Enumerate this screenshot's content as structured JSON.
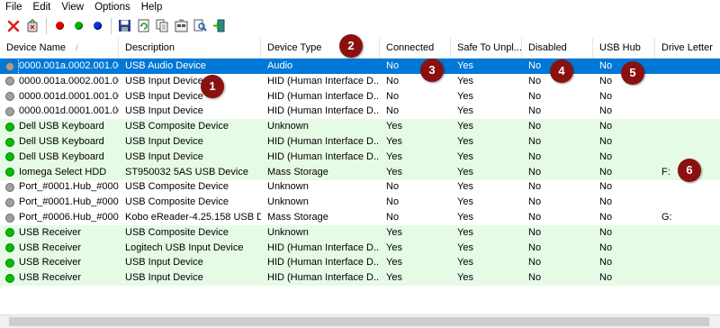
{
  "menu": [
    "File",
    "Edit",
    "View",
    "Options",
    "Help"
  ],
  "toolbar_icons": [
    "delete-icon",
    "uninstall-icon",
    "red-light-icon",
    "green-light-icon",
    "blue-light-icon",
    "save-icon",
    "refresh-icon",
    "copy-icon",
    "properties-icon",
    "find-icon",
    "exit-icon"
  ],
  "columns": [
    "Device Name",
    "Description",
    "Device Type",
    "Connected",
    "Safe To Unpl...",
    "Disabled",
    "USB Hub",
    "Drive Letter"
  ],
  "sort_indicator": "/",
  "colors": {
    "selected": "#0078d7",
    "connected_row": "#e6fbe6",
    "green_dot": "#00c000",
    "gray_dot": "#a0a0a0",
    "badge": "#8b1010"
  },
  "rows": [
    {
      "status": "gray",
      "name": "0000.001a.0002.001.00...",
      "desc": "USB Audio Device",
      "type": "Audio",
      "connected": "No",
      "safe": "Yes",
      "disabled": "No",
      "hub": "No",
      "drive": "",
      "selected": true
    },
    {
      "status": "gray",
      "name": "0000.001a.0002.001.00...",
      "desc": "USB Input Device",
      "type": "HID (Human Interface D...",
      "connected": "No",
      "safe": "Yes",
      "disabled": "No",
      "hub": "No",
      "drive": ""
    },
    {
      "status": "gray",
      "name": "0000.001d.0001.001.00...",
      "desc": "USB Input Device",
      "type": "HID (Human Interface D...",
      "connected": "No",
      "safe": "Yes",
      "disabled": "No",
      "hub": "No",
      "drive": ""
    },
    {
      "status": "gray",
      "name": "0000.001d.0001.001.00...",
      "desc": "USB Input Device",
      "type": "HID (Human Interface D...",
      "connected": "No",
      "safe": "Yes",
      "disabled": "No",
      "hub": "No",
      "drive": ""
    },
    {
      "status": "green",
      "name": "Dell USB Keyboard",
      "desc": "USB Composite Device",
      "type": "Unknown",
      "connected": "Yes",
      "safe": "Yes",
      "disabled": "No",
      "hub": "No",
      "drive": ""
    },
    {
      "status": "green",
      "name": "Dell USB Keyboard",
      "desc": "USB Input Device",
      "type": "HID (Human Interface D...",
      "connected": "Yes",
      "safe": "Yes",
      "disabled": "No",
      "hub": "No",
      "drive": ""
    },
    {
      "status": "green",
      "name": "Dell USB Keyboard",
      "desc": "USB Input Device",
      "type": "HID (Human Interface D...",
      "connected": "Yes",
      "safe": "Yes",
      "disabled": "No",
      "hub": "No",
      "drive": ""
    },
    {
      "status": "green",
      "name": "Iomega Select HDD",
      "desc": "ST950032 5AS USB Device",
      "type": "Mass Storage",
      "connected": "Yes",
      "safe": "Yes",
      "disabled": "No",
      "hub": "No",
      "drive": "F:"
    },
    {
      "status": "gray",
      "name": "Port_#0001.Hub_#0005",
      "desc": "USB Composite Device",
      "type": "Unknown",
      "connected": "No",
      "safe": "Yes",
      "disabled": "No",
      "hub": "No",
      "drive": ""
    },
    {
      "status": "gray",
      "name": "Port_#0001.Hub_#0009",
      "desc": "USB Composite Device",
      "type": "Unknown",
      "connected": "No",
      "safe": "Yes",
      "disabled": "No",
      "hub": "No",
      "drive": ""
    },
    {
      "status": "gray",
      "name": "Port_#0006.Hub_#0001",
      "desc": "Kobo eReader-4.25.158 USB D...",
      "type": "Mass Storage",
      "connected": "No",
      "safe": "Yes",
      "disabled": "No",
      "hub": "No",
      "drive": "G:"
    },
    {
      "status": "green",
      "name": "USB Receiver",
      "desc": "USB Composite Device",
      "type": "Unknown",
      "connected": "Yes",
      "safe": "Yes",
      "disabled": "No",
      "hub": "No",
      "drive": ""
    },
    {
      "status": "green",
      "name": "USB Receiver",
      "desc": "Logitech USB Input Device",
      "type": "HID (Human Interface D...",
      "connected": "Yes",
      "safe": "Yes",
      "disabled": "No",
      "hub": "No",
      "drive": ""
    },
    {
      "status": "green",
      "name": "USB Receiver",
      "desc": "USB Input Device",
      "type": "HID (Human Interface D...",
      "connected": "Yes",
      "safe": "Yes",
      "disabled": "No",
      "hub": "No",
      "drive": ""
    },
    {
      "status": "green",
      "name": "USB Receiver",
      "desc": "USB Input Device",
      "type": "HID (Human Interface D...",
      "connected": "Yes",
      "safe": "Yes",
      "disabled": "No",
      "hub": "No",
      "drive": ""
    }
  ],
  "callouts": [
    "1",
    "2",
    "3",
    "4",
    "5",
    "6"
  ]
}
